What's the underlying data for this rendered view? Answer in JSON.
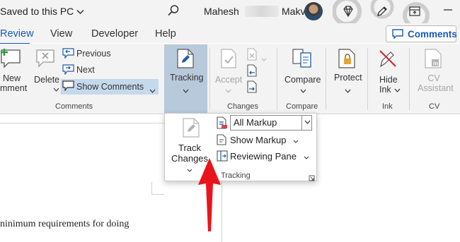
{
  "titlebar": {
    "saved_status": "Saved to this PC",
    "user_first": "Mahesh",
    "user_last": "Makvana"
  },
  "tabs": [
    {
      "label": "Review",
      "active": true
    },
    {
      "label": "View",
      "active": false
    },
    {
      "label": "Developer",
      "active": false
    },
    {
      "label": "Help",
      "active": false
    }
  ],
  "comments_button": {
    "label": "Comments"
  },
  "ribbon": {
    "comments_group": {
      "label": "Comments",
      "new_comment_line1": "New",
      "new_comment_line2": "mment",
      "delete": "Delete",
      "previous": "Previous",
      "next": "Next",
      "show_comments": "Show Comments"
    },
    "tracking": {
      "label": "Tracking"
    },
    "changes_group": {
      "label": "Changes",
      "accept": "Accept"
    },
    "compare_group": {
      "label": "Compare",
      "compare": "Compare"
    },
    "protect": {
      "label": "Protect"
    },
    "ink_group": {
      "label": "Ink",
      "hide_ink_line1": "Hide",
      "hide_ink_line2": "Ink"
    },
    "cv_group": {
      "label": "CV",
      "cv_line1": "CV",
      "cv_line2": "Assistant"
    }
  },
  "tracking_panel": {
    "track_changes_line1": "Track",
    "track_changes_line2": "Changes",
    "markup_value": "All Markup",
    "show_markup": "Show Markup",
    "reviewing_pane": "Reviewing Pane",
    "group_label": "Tracking"
  },
  "document": {
    "text": "ninimum requirements for doing"
  },
  "colors": {
    "accent": "#185abd",
    "arrow": "#e8141c",
    "tracking_pressed": "#b9c9dc"
  }
}
